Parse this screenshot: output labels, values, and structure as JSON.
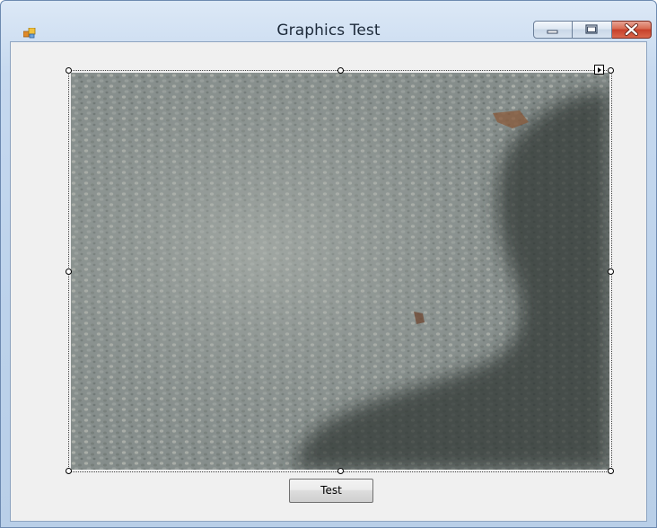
{
  "window": {
    "title": "Graphics Test",
    "icon": "winforms-app-icon"
  },
  "caption_buttons": {
    "minimize": "minimize-icon",
    "maximize": "maximize-icon",
    "close": "close-icon"
  },
  "form": {
    "picture": "gravel photo with shadow",
    "button_label": "Test"
  },
  "colors": {
    "client_background": "#f0f0f0",
    "close_button": "#c7402a"
  }
}
